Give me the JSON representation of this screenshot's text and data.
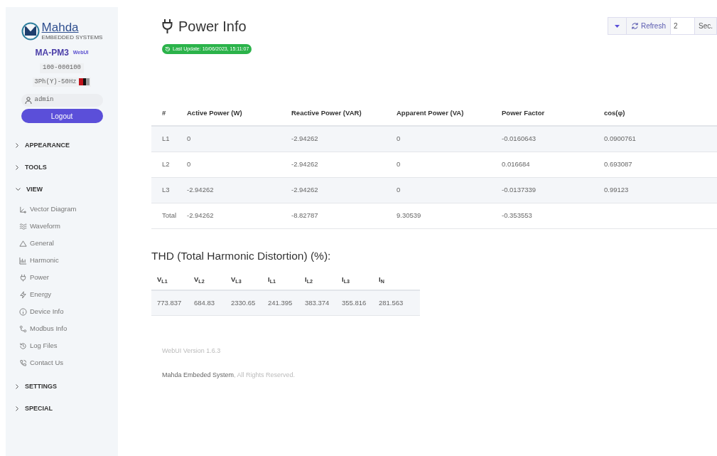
{
  "sidebar": {
    "logo": {
      "name": "Mahda",
      "tagline": "EMBEDDED SYSTEMS"
    },
    "model": "MA-PM3",
    "badge": "WebUI",
    "serial": "100-000100",
    "config": "3Ph(Y)-50Hz",
    "user": "admin",
    "logout": "Logout",
    "sections": [
      {
        "label": "APPEARANCE",
        "expanded": false
      },
      {
        "label": "TOOLS",
        "expanded": false
      },
      {
        "label": "VIEW",
        "expanded": true,
        "children": [
          {
            "label": "Vector Diagram"
          },
          {
            "label": "Waveform"
          },
          {
            "label": "General"
          },
          {
            "label": "Harmonic"
          },
          {
            "label": "Power"
          },
          {
            "label": "Energy"
          },
          {
            "label": "Device Info"
          },
          {
            "label": "Modbus Info"
          },
          {
            "label": "Log Files"
          },
          {
            "label": "Contact Us"
          }
        ]
      },
      {
        "label": "SETTINGS",
        "expanded": false
      },
      {
        "label": "SPECIAL",
        "expanded": false
      }
    ]
  },
  "header": {
    "title": "Power Info",
    "last_update": "Last Update: 10/06/2023, 15:11:07"
  },
  "toolbar": {
    "refresh": "Refresh",
    "interval": "2",
    "unit": "Sec."
  },
  "power_table": {
    "columns": [
      "#",
      "Active Power (W)",
      "Reactive Power (VAR)",
      "Apparent Power (VA)",
      "Power Factor",
      "cos(φ)"
    ],
    "rows": [
      [
        "L1",
        "0",
        "-2.94262",
        "0",
        "-0.0160643",
        "0.0900761"
      ],
      [
        "L2",
        "0",
        "-2.94262",
        "0",
        "0.016684",
        "0.693087"
      ],
      [
        "L3",
        "-2.94262",
        "-2.94262",
        "0",
        "-0.0137339",
        "0.99123"
      ],
      [
        "Total",
        "-2.94262",
        "-8.82787",
        "9.30539",
        "-0.353553",
        ""
      ]
    ]
  },
  "thd": {
    "title": "THD (Total Harmonic Distortion) (%):",
    "columns": [
      "V$_{L1}$",
      "V$_{L2}$",
      "V$_{L3}$",
      "I$_{L1}$",
      "I$_{L2}$",
      "I$_{L3}$",
      "I$_{N}$"
    ],
    "values": [
      "773.837",
      "684.83",
      "2330.65",
      "241.395",
      "383.374",
      "355.816",
      "281.563"
    ]
  },
  "footer": {
    "version": "WebUI Version 1.6.3",
    "company": "Mahda Embeded System",
    "rights": ", All Rights Reserved."
  }
}
